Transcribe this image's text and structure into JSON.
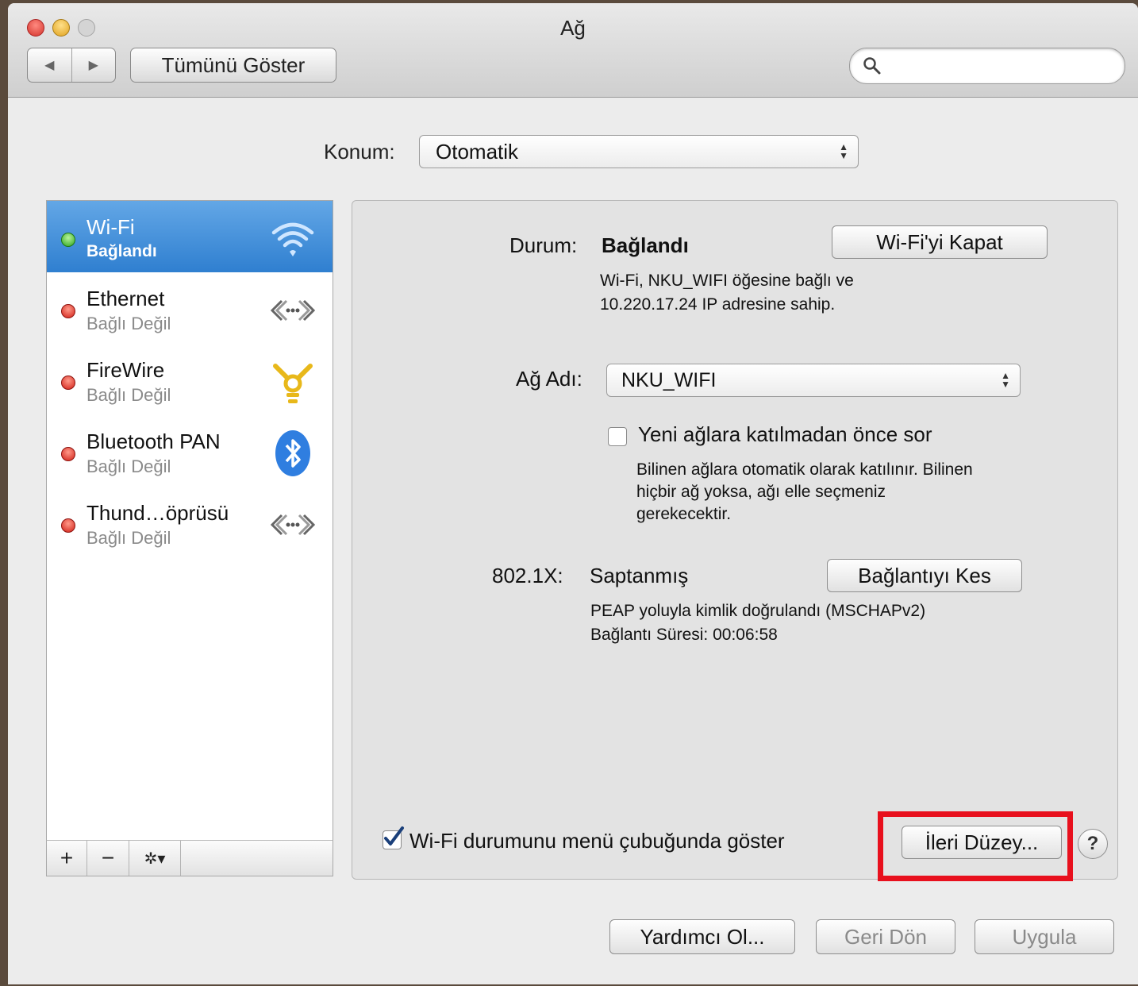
{
  "window": {
    "title": "Ağ"
  },
  "toolbar": {
    "back_icon": "◀",
    "forward_icon": "▶",
    "show_all_label": "Tümünü Göster",
    "search_placeholder": ""
  },
  "location": {
    "label": "Konum:",
    "value": "Otomatik"
  },
  "services": [
    {
      "name": "Wi-Fi",
      "status": "Bağlandı",
      "state": "green",
      "icon": "wifi-icon",
      "selected": true
    },
    {
      "name": "Ethernet",
      "status": "Bağlı Değil",
      "state": "red",
      "icon": "ethernet-icon",
      "selected": false
    },
    {
      "name": "FireWire",
      "status": "Bağlı Değil",
      "state": "red",
      "icon": "firewire-icon",
      "selected": false
    },
    {
      "name": "Bluetooth PAN",
      "status": "Bağlı Değil",
      "state": "red",
      "icon": "bluetooth-icon",
      "selected": false
    },
    {
      "name": "Thund…öprüsü",
      "status": "Bağlı Değil",
      "state": "red",
      "icon": "thunderbolt-bridge-icon",
      "selected": false
    }
  ],
  "list_toolbar": {
    "add": "+",
    "remove": "−",
    "action": "✲▾"
  },
  "detail": {
    "status_label": "Durum:",
    "status_value": "Bağlandı",
    "wifi_off_button": "Wi-Fi'yi Kapat",
    "status_desc_1": "Wi-Fi, NKU_WIFI öğesine bağlı ve",
    "status_desc_2": "10.220.17.24 IP adresine sahip.",
    "network_name_label": "Ağ Adı:",
    "network_name_value": "NKU_WIFI",
    "ask_join_label": "Yeni ağlara katılmadan önce sor",
    "ask_join_checked": false,
    "ask_join_desc_1": "Bilinen ağlara otomatik olarak katılınır. Bilinen",
    "ask_join_desc_2": "hiçbir ağ yoksa, ağı elle seçmeniz",
    "ask_join_desc_3": "gerekecektir.",
    "dot1x_label": "802.1X:",
    "dot1x_value": "Saptanmış",
    "disconnect_button": "Bağlantıyı Kes",
    "dot1x_desc_1": "PEAP yoluyla kimlik doğrulandı (MSCHAPv2)",
    "dot1x_desc_2": "Bağlantı Süresi: 00:06:58",
    "show_menu_label": "Wi-Fi durumunu menü çubuğunda göster",
    "show_menu_checked": true,
    "advanced_button": "İleri Düzey...",
    "help_label": "?"
  },
  "footer": {
    "assist_button": "Yardımcı Ol...",
    "revert_button": "Geri Dön",
    "apply_button": "Uygula"
  },
  "colors": {
    "selection": "#3a86d4",
    "highlight_box": "#e8101d"
  }
}
